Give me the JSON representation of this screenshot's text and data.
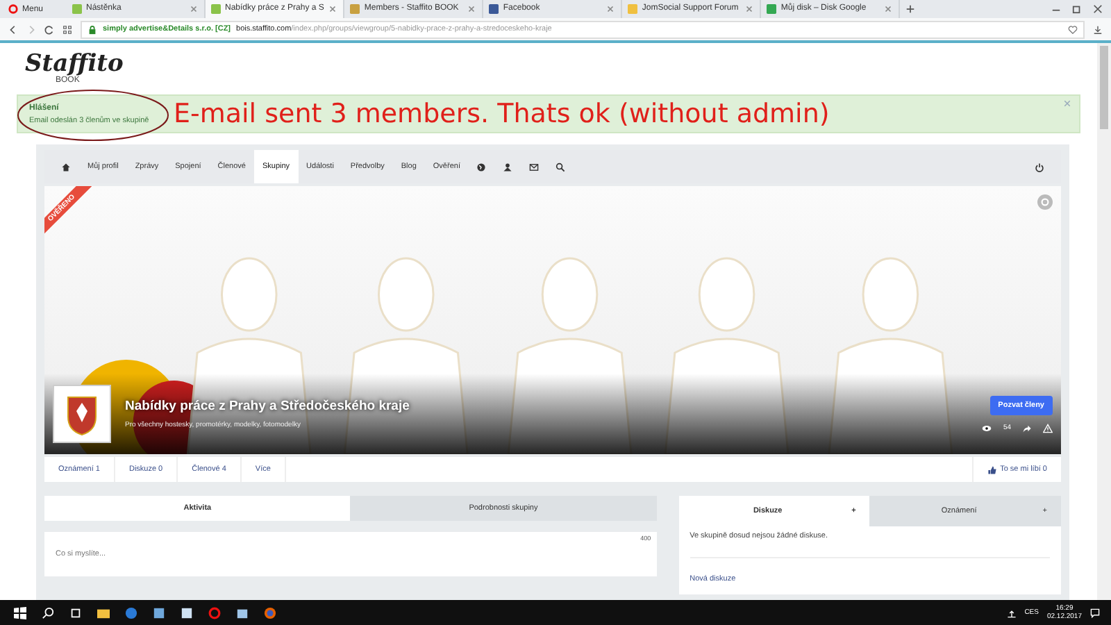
{
  "browser": {
    "menu": "Menu",
    "tabs": [
      {
        "label": "Nástěnka",
        "selected": false
      },
      {
        "label": "Nabídky práce z Prahy a S",
        "selected": true
      },
      {
        "label": "Members - Staffito BOOK",
        "selected": false
      },
      {
        "label": "Facebook",
        "selected": false
      },
      {
        "label": "JomSocial Support Forum",
        "selected": false
      },
      {
        "label": "Můj disk – Disk Google",
        "selected": false
      }
    ],
    "certificate": "simply advertise&Details s.r.o. [CZ]",
    "host": "bois.staffito.com",
    "path": "/index.php/groups/viewgroup/5-nabidky-prace-z-prahy-a-stredoceskeho-kraje"
  },
  "logo": {
    "name": "Staffito",
    "sub": "BOOK"
  },
  "alert": {
    "title": "Hlášení",
    "message": "Email odeslán 3 členům ve skupině"
  },
  "annotation": "E-mail sent 3 members. Thats ok (without admin)",
  "nav": [
    {
      "label": "Můj profil",
      "selected": false
    },
    {
      "label": "Zprávy",
      "selected": false
    },
    {
      "label": "Spojení",
      "selected": false
    },
    {
      "label": "Členové",
      "selected": false
    },
    {
      "label": "Skupiny",
      "selected": true
    },
    {
      "label": "Události",
      "selected": false
    },
    {
      "label": "Předvolby",
      "selected": false
    },
    {
      "label": "Blog",
      "selected": false
    },
    {
      "label": "Ověření",
      "selected": false
    }
  ],
  "group": {
    "badge": "OVĚŘENO",
    "title": "Nabídky práce z Prahy a Středočeského kraje",
    "subtitle": "Pro všechny hostesky, promotérky, modelky, fotomodelky",
    "invite": "Pozvat členy",
    "views": "54"
  },
  "group_tabs": [
    "Oznámení 1",
    "Diskuze 0",
    "Členové 4",
    "Více"
  ],
  "like": "To se mi líbí 0",
  "left_tabs": [
    {
      "label": "Aktivita",
      "selected": true
    },
    {
      "label": "Podrobnosti skupiny",
      "selected": false
    }
  ],
  "status": {
    "placeholder": "Co si myslíte...",
    "counter": "400"
  },
  "right_tabs": [
    {
      "label": "Diskuze",
      "selected": true
    },
    {
      "label": "Oznámení",
      "selected": false
    }
  ],
  "plus": "+",
  "empty": "Ve skupině dosud nejsou žádné diskuse.",
  "new_link": "Nová diskuze",
  "taskbar": {
    "lang": "CES",
    "time": "16:29",
    "date": "02.12.2017"
  }
}
